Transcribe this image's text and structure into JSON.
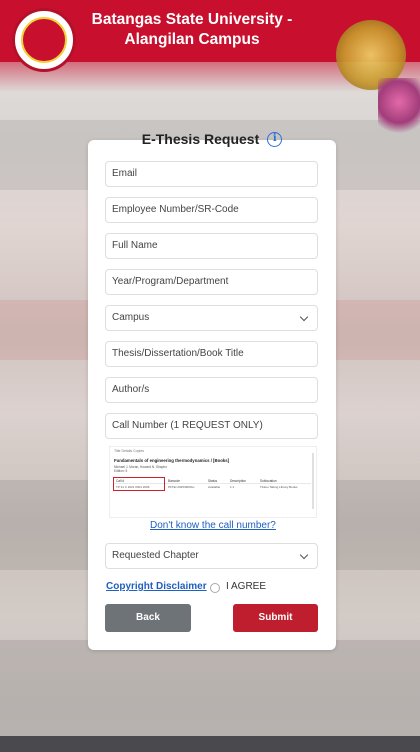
{
  "header": {
    "title_line1": "Batangas State University -",
    "title_line2": "Alangilan Campus",
    "brand_color": "#c8102e",
    "logo_icon": "university-seal-icon",
    "seal_icon": "engineering-gear-seal-icon"
  },
  "form": {
    "title": "E-Thesis Request",
    "info_icon": "info-icon",
    "fields": {
      "email": "Email",
      "employee_number": "Employee Number/SR-Code",
      "full_name": "Full Name",
      "year_program": "Year/Program/Department",
      "campus": "Campus",
      "thesis_title": "Thesis/Dissertation/Book Title",
      "authors": "Author/s",
      "call_number": "Call Number (1 REQUEST ONLY)",
      "requested_chapter": "Requested Chapter"
    },
    "sample_image": {
      "tabs": "Title Details     Copies",
      "title": "Fundamentals of engineering thermodynamics / [Books]",
      "meta1": "Michael J. Moran, Howard N. Shapiro",
      "meta2": "Edition: 5",
      "columns": [
        "Call #",
        "Barcode",
        "Status",
        "Description",
        "Sublocation"
      ],
      "row": [
        "TP 31 C 2021 0001 2006",
        "PFTEI 2025/0000xx",
        "Available",
        "1.1",
        "Tinkus Tabing Library Books"
      ]
    },
    "call_number_help": "Don't know the call number?",
    "copyright_link": "Copyright Disclaimer",
    "agree_label": "I AGREE",
    "back_label": "Back",
    "submit_label": "Submit",
    "accent_link_color": "#1f5fbf",
    "submit_color": "#be1e2d"
  }
}
